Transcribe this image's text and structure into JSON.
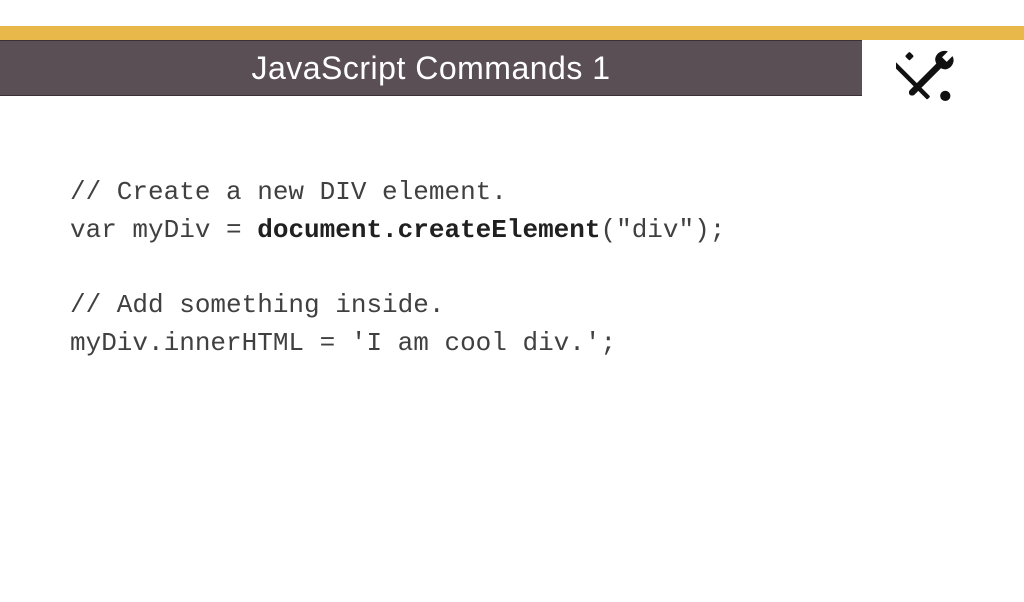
{
  "header": {
    "title": "JavaScript Commands 1"
  },
  "code": {
    "line1": "// Create a new DIV element.",
    "line2a": "var myDiv = ",
    "line2b": "document.createElement",
    "line2c": "(\"div\");",
    "line3": "// Add something inside.",
    "line4": "myDiv.innerHTML = 'I am cool div.';"
  }
}
